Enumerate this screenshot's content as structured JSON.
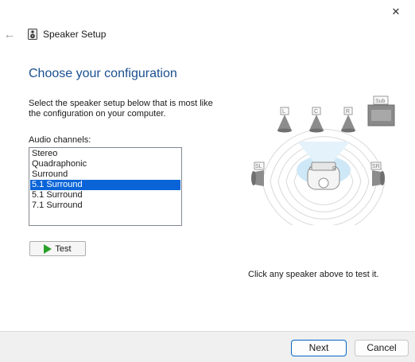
{
  "window": {
    "title": "Speaker Setup",
    "close_symbol": "✕",
    "back_symbol": "←"
  },
  "main": {
    "heading": "Choose your configuration",
    "instructions": "Select the speaker setup below that is most like the configuration on your computer.",
    "channels_label": "Audio channels:",
    "channels": [
      {
        "label": "Stereo",
        "selected": false
      },
      {
        "label": "Quadraphonic",
        "selected": false
      },
      {
        "label": "Surround",
        "selected": false
      },
      {
        "label": "5.1 Surround",
        "selected": true
      },
      {
        "label": "5.1 Surround",
        "selected": false
      },
      {
        "label": "7.1 Surround",
        "selected": false
      }
    ],
    "test_label": "Test",
    "hint": "Click any speaker above to test it."
  },
  "diagram": {
    "speakers": {
      "front_left": "L",
      "center": "C",
      "front_right": "R",
      "subwoofer": "Sub",
      "side_left": "SL",
      "side_right": "SR",
      "listener_left": "L",
      "listener_right": "R"
    }
  },
  "footer": {
    "next_label": "Next",
    "cancel_label": "Cancel"
  },
  "colors": {
    "heading": "#1a4f8f",
    "selection": "#0a64d8",
    "play": "#2aa12a",
    "accent_border": "#0067c0"
  }
}
